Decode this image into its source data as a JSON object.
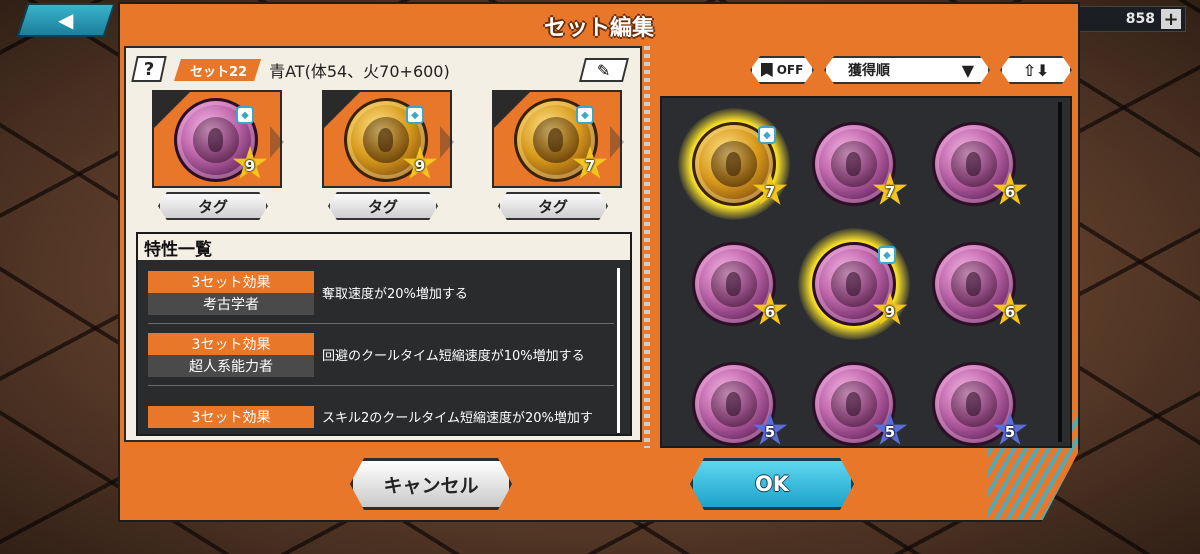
{
  "header": {
    "title": "セット編集",
    "back_icon": "◀",
    "currency_value": "858",
    "currency_plus": "+"
  },
  "set": {
    "help_label": "?",
    "set_label": "セット22",
    "set_name": "青AT(体54、火70+600)",
    "edit_icon": "✎"
  },
  "slots": [
    {
      "type": "pink",
      "stars": "9",
      "star_color": "gold",
      "tag_label": "タグ"
    },
    {
      "type": "gold",
      "stars": "9",
      "star_color": "gold",
      "tag_label": "タグ"
    },
    {
      "type": "gold",
      "stars": "7",
      "star_color": "gold",
      "tag_label": "タグ"
    }
  ],
  "traits": {
    "title": "特性一覧",
    "items": [
      {
        "effect": "3セット効果",
        "name": "考古学者",
        "desc": "奪取速度が20%増加する"
      },
      {
        "effect": "3セット効果",
        "name": "超人系能力者",
        "desc": "回避のクールタイム短縮速度が10%増加する"
      },
      {
        "effect": "3セット効果",
        "name": "",
        "desc": "スキル2のクールタイム短縮速度が20%増加す"
      }
    ]
  },
  "controls": {
    "favorite_toggle": "OFF",
    "sort_label": "獲得順",
    "sort_dropdown_icon": "▼",
    "order_icon": "⇧⬇"
  },
  "inventory": [
    {
      "type": "gold",
      "stars": "7",
      "star_color": "gold",
      "equipped": true
    },
    {
      "type": "pink",
      "stars": "7",
      "star_color": "gold",
      "equipped": false
    },
    {
      "type": "pink",
      "stars": "6",
      "star_color": "gold",
      "equipped": false
    },
    {
      "type": "pink",
      "stars": "6",
      "star_color": "gold",
      "equipped": false
    },
    {
      "type": "pink",
      "stars": "9",
      "star_color": "gold",
      "equipped": true
    },
    {
      "type": "pink",
      "stars": "6",
      "star_color": "gold",
      "equipped": false
    },
    {
      "type": "pink",
      "stars": "5",
      "star_color": "blue",
      "equipped": false
    },
    {
      "type": "pink",
      "stars": "5",
      "star_color": "blue",
      "equipped": false
    },
    {
      "type": "pink",
      "stars": "5",
      "star_color": "blue",
      "equipped": false
    }
  ],
  "buttons": {
    "cancel": "キャンセル",
    "ok": "OK"
  }
}
